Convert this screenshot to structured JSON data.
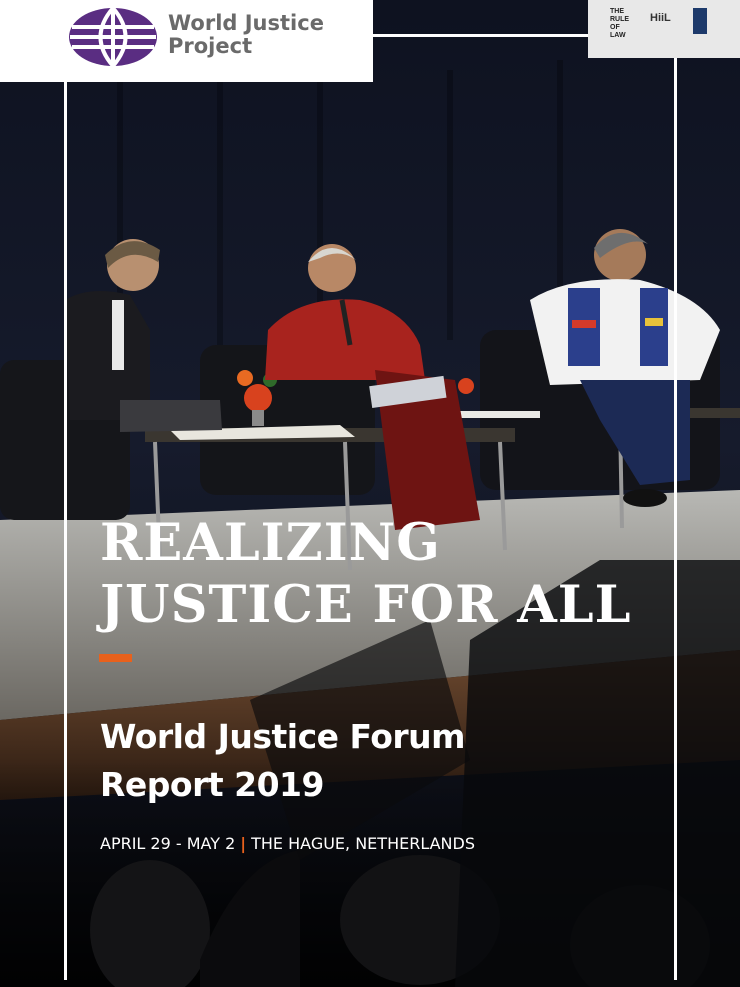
{
  "logo": {
    "line1": "World Justice",
    "line2": "Project"
  },
  "headline": {
    "line1": "REALIZING",
    "line2": "JUSTICE FOR ALL"
  },
  "subtitle": {
    "line1": "World Justice Forum",
    "line2": "Report 2019"
  },
  "dateline": {
    "dates": "APRIL 29 - MAY 2",
    "separator": "|",
    "location": "THE HAGUE, NETHERLANDS"
  },
  "sponsors": {
    "board_text_1": "THE RULE OF LAW",
    "board_text_2": "HiiL"
  },
  "colors": {
    "brand_purple": "#5a2d82",
    "accent_orange": "#e8611c",
    "logo_text_gray": "#6a6a6a",
    "frame_white": "#ffffff"
  },
  "icons": {
    "logo_icon": "globe-icon"
  }
}
